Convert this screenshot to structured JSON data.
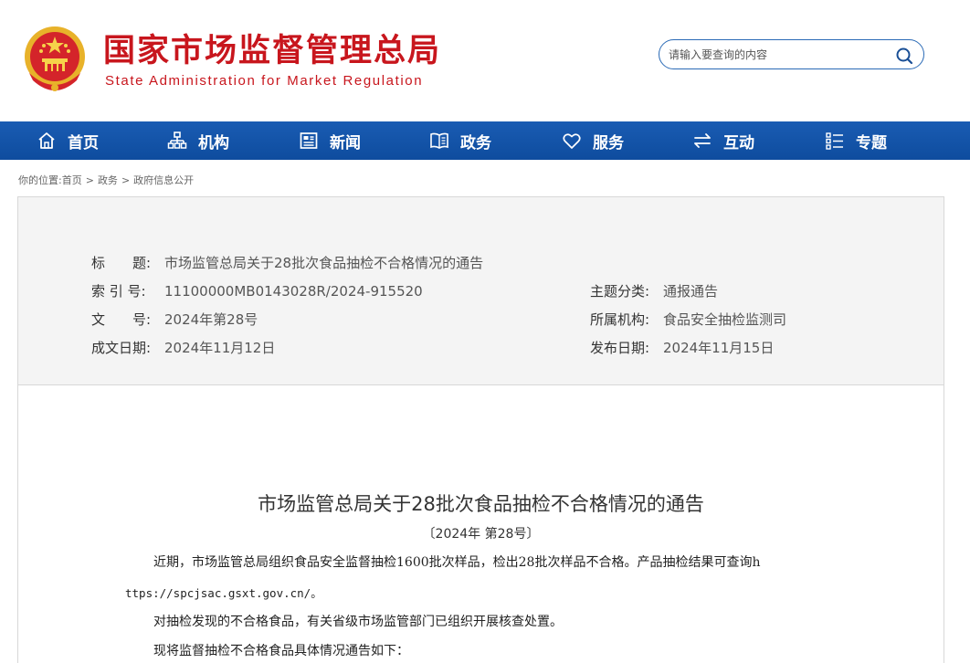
{
  "header": {
    "site_title": "国家市场监督管理总局",
    "site_subtitle": "State Administration for Market Regulation",
    "emblem_icon": "national-emblem-icon",
    "search": {
      "placeholder": "请输入要查询的内容",
      "value": "",
      "button_icon": "search-icon"
    }
  },
  "colors": {
    "brand_red": "#c8161d",
    "nav_blue": "#1a5cb3",
    "search_border": "#2a6ab6"
  },
  "nav": {
    "items": [
      {
        "label": "首页",
        "icon": "home-icon"
      },
      {
        "label": "机构",
        "icon": "org-chart-icon"
      },
      {
        "label": "新闻",
        "icon": "newspaper-icon"
      },
      {
        "label": "政务",
        "icon": "book-icon"
      },
      {
        "label": "服务",
        "icon": "heart-icon"
      },
      {
        "label": "互动",
        "icon": "swap-arrows-icon"
      },
      {
        "label": "专题",
        "icon": "list-icon"
      }
    ]
  },
  "breadcrumb": {
    "prefix": "你的位置:",
    "items": [
      "首页",
      "政务",
      "政府信息公开"
    ],
    "separator": ">"
  },
  "meta": {
    "title_label": "标　　题:",
    "title_value": "市场监管总局关于28批次食品抽检不合格情况的通告",
    "index_label": "索 引 号:",
    "index_value": "11100000MB0143028R/2024-915520",
    "doc_no_label": "文　　号:",
    "doc_no_value": "2024年第28号",
    "date_written_label": "成文日期:",
    "date_written_value": "2024年11月12日",
    "topic_label": "主题分类:",
    "topic_value": "通报通告",
    "agency_label": "所属机构:",
    "agency_value": "食品安全抽检监测司",
    "date_published_label": "发布日期:",
    "date_published_value": "2024年11月15日"
  },
  "article": {
    "title": "市场监管总局关于28批次食品抽检不合格情况的通告",
    "number": "〔2024年 第28号〕",
    "para1_line1": "近期，市场监管总局组织食品安全监督抽检1600批次样品，检出28批次样品不合格。产品抽检结果可查询h",
    "para1_line2": "ttps://spcjsac.gsxt.gov.cn/。",
    "para2": "对抽检发现的不合格食品，有关省级市场监管部门已组织开展核查处置。",
    "para3": "现将监督抽检不合格食品具体情况通告如下："
  }
}
